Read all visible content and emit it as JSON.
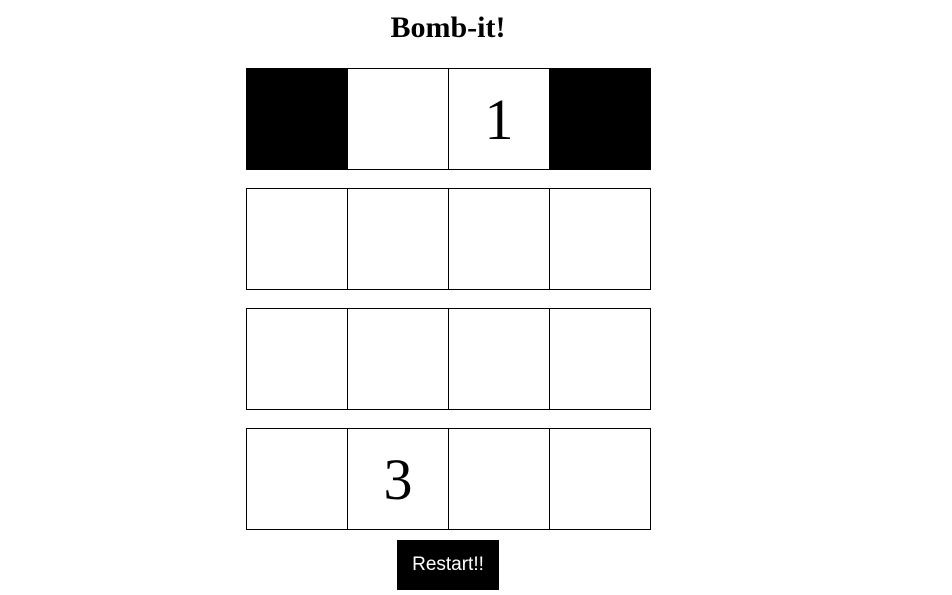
{
  "game": {
    "title": "Bomb-it!",
    "restart_label": "Restart!!",
    "colors": {
      "bomb": "#000000",
      "cell": "#ffffff",
      "button_bg": "#000000",
      "button_text": "#ffffff"
    },
    "grid": [
      [
        {
          "state": "bomb",
          "label": ""
        },
        {
          "state": "revealed",
          "label": ""
        },
        {
          "state": "revealed",
          "label": "1"
        },
        {
          "state": "bomb",
          "label": ""
        }
      ],
      [
        {
          "state": "hidden",
          "label": ""
        },
        {
          "state": "hidden",
          "label": ""
        },
        {
          "state": "hidden",
          "label": ""
        },
        {
          "state": "hidden",
          "label": ""
        }
      ],
      [
        {
          "state": "hidden",
          "label": ""
        },
        {
          "state": "hidden",
          "label": ""
        },
        {
          "state": "hidden",
          "label": ""
        },
        {
          "state": "hidden",
          "label": ""
        }
      ],
      [
        {
          "state": "hidden",
          "label": ""
        },
        {
          "state": "revealed",
          "label": "3"
        },
        {
          "state": "hidden",
          "label": ""
        },
        {
          "state": "hidden",
          "label": ""
        }
      ]
    ]
  }
}
